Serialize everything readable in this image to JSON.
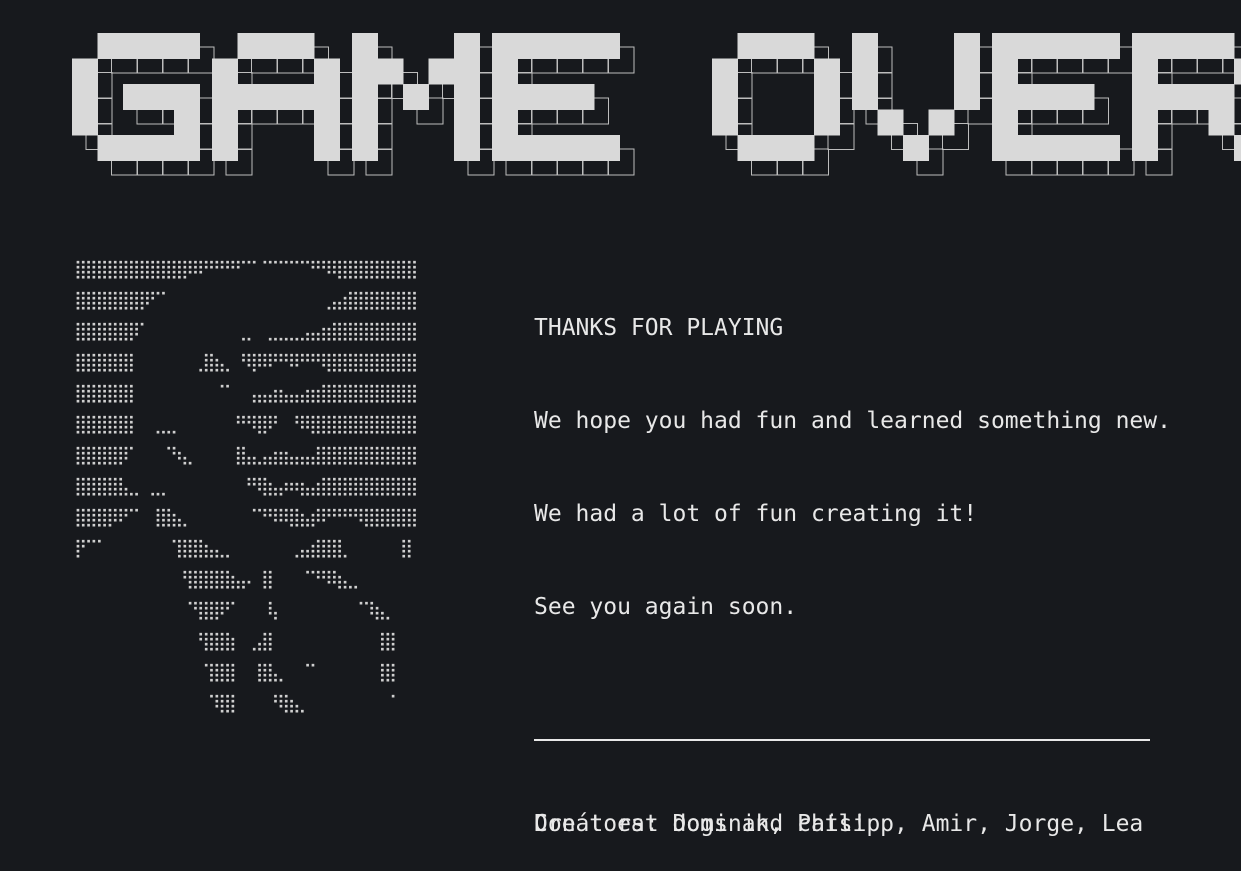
{
  "title": "GAME OVER",
  "colors": {
    "background": "#17191d",
    "text": "#e8e8e8",
    "title_fill": "#d9d9d9",
    "title_shadow": "#bdbdbd"
  },
  "ascii_art": [
    "⣿⣿⣿⣿⣿⣿⣿⣿⣿⣿⡿⠿⠛⠛⠛⠋⠉⠈⠉⠉⠉⠉⠛⠻⢿⣿⣿⣿⣿⣿⣿⣿",
    "⣿⣿⣿⣿⣿⣿⡿⠋⠁⠀⠀⠀⠀⠀⠀⠀⠀⠀⠀⠀⠀⠀⠀⢀⣤⣾⣿⣿⣿⣿⣿⣿",
    "⣿⣿⣿⣿⣿⡿⠁⠀⠀⠀⠀⠀⠀⠀⠀⢀⡀⠀⣀⣀⣀⣠⣤⣶⣿⣿⣿⣿⣿⣿⣿⣿",
    "⣿⣿⣿⣿⣿⡇⠀⠀⠀⠀⠀⢀⣿⣦⡀⠘⢿⠿⠟⠛⠿⠛⠛⢿⣿⣿⣿⣿⣿⣿⣿⣿",
    "⣿⣿⣿⣿⣿⡇⠀⠀⠀⠀⠀⠀⠀⠈⠁⠀⢠⣤⣴⣦⣤⣴⣶⣿⣿⣿⣿⣿⣿⣿⣿⣿",
    "⣿⣿⣿⣿⣿⡇⠀⢀⣀⡀⠀⠀⠀⠀⠀⠛⠻⣿⠟⠀⠘⠿⣿⣿⣿⣿⣿⣿⣿⣿⣿⣿",
    "⣿⣿⣿⣿⡿⠁⠀⠀⠈⠳⣄⠀⠀⠀⠀⣿⣤⣠⣴⣶⣤⣤⣼⣿⣿⣿⣿⣿⣿⣿⣿⣿",
    "⣿⣿⣿⣿⣧⣀⠀⣀⡀⠀⠀⠀⠀⠀⠀⠀⠛⢿⣦⡴⠶⣦⣴⣿⣿⣿⣿⣿⣿⣿⣿⣿",
    "⣿⣿⣿⡿⠟⠉⠀⢸⣿⣦⡀⠀⠀⠀⠀⠀⠈⠙⠻⠿⣿⣦⡾⠟⠛⠛⠻⣿⣿⣿⣿⣿",
    "⡟⠉⠁⠀⠀⠀⠀⠀⠀⢹⣿⣿⣦⣄⡀⠀⠀⠀⠀⠀⢀⣤⣾⣿⣿⡀⠀⠀⠀⠀⢸⡇",
    "⠀⠀⠀⠀⠀⠀⠀⠀⠀⠀⢻⣿⣿⣿⣷⣤⠄⢸⡇⠀⠀⠈⠙⠻⢷⣄⡀⠀⠀⠀⠀⠀",
    "⠀⠀⠀⠀⠀⠀⠀⠀⠀⠀⠈⢻⣿⡿⠋⠀⠀⠀⢧⠀⠀⠀⠀⠀⠀⠀⠈⠹⣦⡀⠀⠀",
    "⠀⠀⠀⠀⠀⠀⠀⠀⠀⠀⠀⠘⣿⣿⣷⠀⢀⣼⡇⠀⠀⠀⠀⠀⠀⠀⠀⠀⢸⣿⠀⠀",
    "⠀⠀⠀⠀⠀⠀⠀⠀⠀⠀⠀⠀⢹⣿⣿⠀⠀⣿⣧⡀⠀⠈⠁⠀⠀⠀⠀⠀⢸⣿⠀⠀",
    "⠀⠀⠀⠀⠀⠀⠀⠀⠀⠀⠀⠀⠈⢿⣿⠀⠀⠀⠘⢿⣦⡀⠀⠀⠀⠀⠀⠀⠀⠈⠀⠀"
  ],
  "message": {
    "heading": "THANKS FOR PLAYING",
    "line1": "We hope you had fun and learned something new.",
    "line2": "We had a lot of fun creating it!",
    "line3": "See you again soon.",
    "tagline": "Don´t eat dogs and cats!"
  },
  "footer": {
    "credits": "Creators: Dominik, Philipp, Amir, Jorge, Lea"
  }
}
